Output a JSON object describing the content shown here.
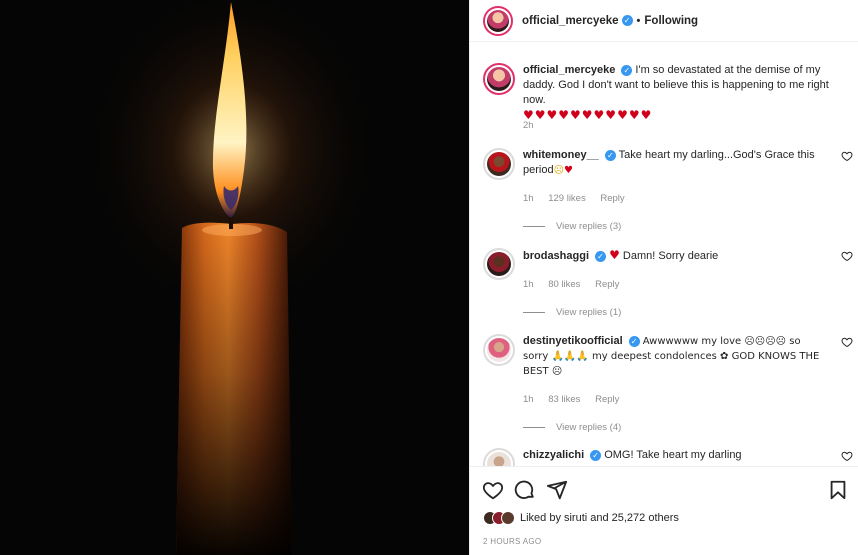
{
  "header": {
    "username": "official_mercyeke",
    "separator": "•",
    "follow_label": "Following"
  },
  "caption": {
    "username": "official_mercyeke",
    "text": "I'm so devastated at the demise of my daddy. God I don't want to believe this is happening to me right now.",
    "hearts": "♥♥♥♥♥♥♥♥♥♥♥",
    "time": "2h"
  },
  "comments": [
    {
      "username": "whitemoney__",
      "text": "Take heart my darling...God's Grace this period",
      "emoji": "☹♥",
      "time": "1h",
      "likes": "129 likes",
      "reply": "Reply",
      "view_replies": "View replies (3)"
    },
    {
      "username": "brodashaggi",
      "text_prefix": "♥",
      "text": "Damn! Sorry dearie",
      "time": "1h",
      "likes": "80 likes",
      "reply": "Reply",
      "view_replies": "View replies (1)"
    },
    {
      "username": "destinyetikoofficial",
      "text": "Awwwwww my love ☹☹☹☹ so sorry 🙏🙏🙏 my deepest condolences ✿ GOD KNOWS THE BEST ☹",
      "time": "1h",
      "likes": "83 likes",
      "reply": "Reply",
      "view_replies": "View replies (4)"
    },
    {
      "username": "chizzyalichi",
      "text": "OMG! Take heart my darling"
    }
  ],
  "footer": {
    "liked_by_prefix": "Liked by",
    "liked_by_user": "siruti",
    "liked_by_suffix": "and 25,272 others",
    "timestamp": "2 HOURS AGO"
  },
  "icons": {
    "like": "heart-outline-icon",
    "comment": "comment-bubble-icon",
    "share": "paper-plane-icon",
    "save": "bookmark-icon"
  },
  "colors": {
    "verified": "#3897f0",
    "heart": "#d0021b",
    "muted": "#8e8e8e"
  }
}
